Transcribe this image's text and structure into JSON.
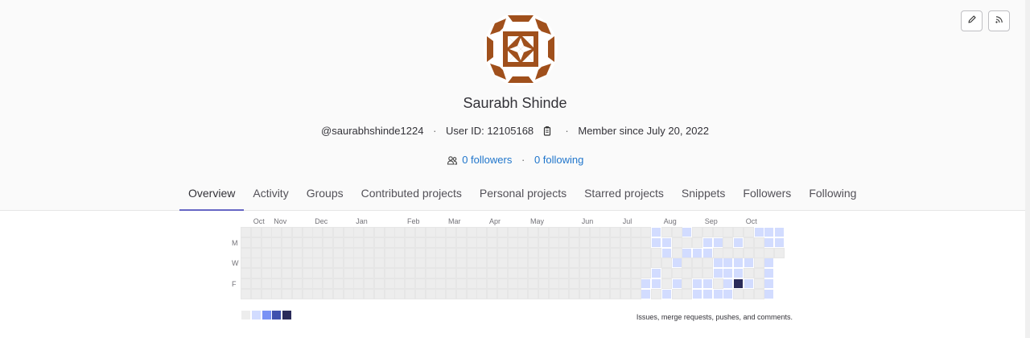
{
  "profile": {
    "name": "Saurabh Shinde",
    "username": "@saurabhshinde1224",
    "user_id": "User ID: 12105168",
    "member_since": "Member since July 20, 2022",
    "followers": "0 followers",
    "following": "0 following",
    "separator": "·"
  },
  "colors": {
    "avatar_brown": "#a0501c",
    "link": "#1f75cb",
    "tab_active_border": "#6666c4",
    "empty": "#ededed",
    "level1": "#d2dcff",
    "level2": "#7992f5",
    "level3": "#3f51ae",
    "level4": "#2a2b59"
  },
  "icons": {
    "edit": "pencil-icon",
    "rss": "rss-icon",
    "copy": "copy-icon",
    "users": "users-icon"
  },
  "tabs": [
    {
      "label": "Overview",
      "active": true
    },
    {
      "label": "Activity",
      "active": false
    },
    {
      "label": "Groups",
      "active": false
    },
    {
      "label": "Contributed projects",
      "active": false
    },
    {
      "label": "Personal projects",
      "active": false
    },
    {
      "label": "Starred projects",
      "active": false
    },
    {
      "label": "Snippets",
      "active": false
    },
    {
      "label": "Followers",
      "active": false
    },
    {
      "label": "Following",
      "active": false
    }
  ],
  "calendar": {
    "months": [
      "Oct",
      "Nov",
      "Dec",
      "Jan",
      "Feb",
      "Mar",
      "Apr",
      "May",
      "Jun",
      "Jul",
      "Aug",
      "Sep",
      "Oct"
    ],
    "day_labels": [
      "M",
      "W",
      "F"
    ],
    "week_count": 53,
    "activity": [
      {
        "week": 40,
        "day": 0,
        "level": 1
      },
      {
        "week": 40,
        "day": 1,
        "level": 1
      },
      {
        "week": 41,
        "day": 1,
        "level": 1
      },
      {
        "week": 41,
        "day": 2,
        "level": 1
      },
      {
        "week": 40,
        "day": 5,
        "level": 1
      },
      {
        "week": 39,
        "day": 5,
        "level": 1
      },
      {
        "week": 39,
        "day": 6,
        "level": 1
      },
      {
        "week": 40,
        "day": 4,
        "level": 1
      },
      {
        "week": 42,
        "day": 3,
        "level": 1
      },
      {
        "week": 41,
        "day": 6,
        "level": 1
      },
      {
        "week": 42,
        "day": 5,
        "level": 1
      },
      {
        "week": 43,
        "day": 0,
        "level": 1
      },
      {
        "week": 43,
        "day": 2,
        "level": 1
      },
      {
        "week": 44,
        "day": 2,
        "level": 1
      },
      {
        "week": 45,
        "day": 1,
        "level": 1
      },
      {
        "week": 45,
        "day": 2,
        "level": 1
      },
      {
        "week": 44,
        "day": 5,
        "level": 1
      },
      {
        "week": 44,
        "day": 6,
        "level": 1
      },
      {
        "week": 45,
        "day": 5,
        "level": 1
      },
      {
        "week": 45,
        "day": 6,
        "level": 1
      },
      {
        "week": 46,
        "day": 1,
        "level": 1
      },
      {
        "week": 46,
        "day": 3,
        "level": 1
      },
      {
        "week": 46,
        "day": 4,
        "level": 1
      },
      {
        "week": 46,
        "day": 6,
        "level": 1
      },
      {
        "week": 47,
        "day": 3,
        "level": 1
      },
      {
        "week": 47,
        "day": 4,
        "level": 1
      },
      {
        "week": 47,
        "day": 5,
        "level": 1
      },
      {
        "week": 47,
        "day": 6,
        "level": 1
      },
      {
        "week": 48,
        "day": 1,
        "level": 1
      },
      {
        "week": 48,
        "day": 3,
        "level": 1
      },
      {
        "week": 48,
        "day": 4,
        "level": 1
      },
      {
        "week": 49,
        "day": 3,
        "level": 1
      },
      {
        "week": 48,
        "day": 5,
        "level": 4
      },
      {
        "week": 49,
        "day": 5,
        "level": 1
      },
      {
        "week": 50,
        "day": 0,
        "level": 1
      },
      {
        "week": 51,
        "day": 0,
        "level": 1
      },
      {
        "week": 51,
        "day": 1,
        "level": 1
      },
      {
        "week": 52,
        "day": 0,
        "level": 1
      },
      {
        "week": 52,
        "day": 1,
        "level": 1
      },
      {
        "week": 51,
        "day": 3,
        "level": 1
      },
      {
        "week": 51,
        "day": 4,
        "level": 1
      },
      {
        "week": 51,
        "day": 5,
        "level": 1
      },
      {
        "week": 51,
        "day": 6,
        "level": 1
      }
    ],
    "legend_levels": [
      0,
      1,
      2,
      3,
      4
    ],
    "legend_text": "Issues, merge requests, pushes, and comments."
  }
}
